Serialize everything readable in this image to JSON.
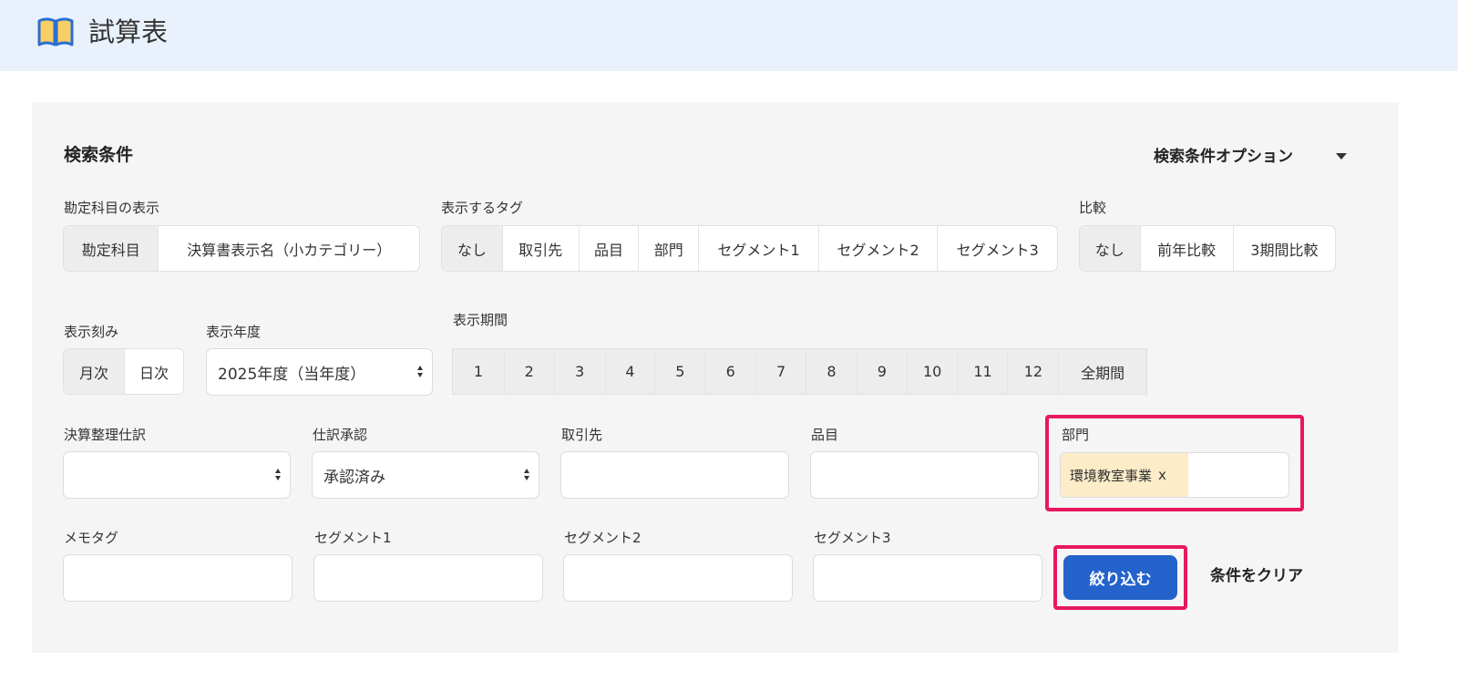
{
  "header": {
    "title": "試算表",
    "icon": "book-icon"
  },
  "panel": {
    "title": "検索条件",
    "options_label": "検索条件オプション"
  },
  "account_display": {
    "label": "勘定科目の表示",
    "options": [
      "勘定科目",
      "決算書表示名（小カテゴリー）"
    ],
    "selected": "勘定科目"
  },
  "tag_display": {
    "label": "表示するタグ",
    "options": [
      "なし",
      "取引先",
      "品目",
      "部門",
      "セグメント1",
      "セグメント2",
      "セグメント3"
    ],
    "selected": "なし"
  },
  "comparison": {
    "label": "比較",
    "options": [
      "なし",
      "前年比較",
      "3期間比較"
    ],
    "selected": "なし"
  },
  "interval": {
    "label": "表示刻み",
    "options": [
      "月次",
      "日次"
    ],
    "selected": "月次"
  },
  "fiscal_year": {
    "label": "表示年度",
    "value": "2025年度（当年度）"
  },
  "period": {
    "label": "表示期間",
    "options": [
      "1",
      "2",
      "3",
      "4",
      "5",
      "6",
      "7",
      "8",
      "9",
      "10",
      "11",
      "12",
      "全期間"
    ]
  },
  "filters": {
    "adjusting_entries": {
      "label": "決算整理仕訳",
      "value": ""
    },
    "approval": {
      "label": "仕訳承認",
      "value": "承認済み"
    },
    "partner": {
      "label": "取引先",
      "value": ""
    },
    "item": {
      "label": "品目",
      "value": ""
    },
    "department": {
      "label": "部門",
      "tag": "環境教室事業",
      "remove": "x"
    },
    "memo_tag": {
      "label": "メモタグ",
      "value": ""
    },
    "segment1": {
      "label": "セグメント1",
      "value": ""
    },
    "segment2": {
      "label": "セグメント2",
      "value": ""
    },
    "segment3": {
      "label": "セグメント3",
      "value": ""
    }
  },
  "actions": {
    "submit_label": "絞り込む",
    "clear_label": "条件をクリア"
  },
  "colors": {
    "header_bg": "#e9f1fc",
    "panel_bg": "#f6f5f5",
    "primary": "#2463cc",
    "highlight": "#e8185f",
    "chip_bg": "#fcecc8"
  }
}
